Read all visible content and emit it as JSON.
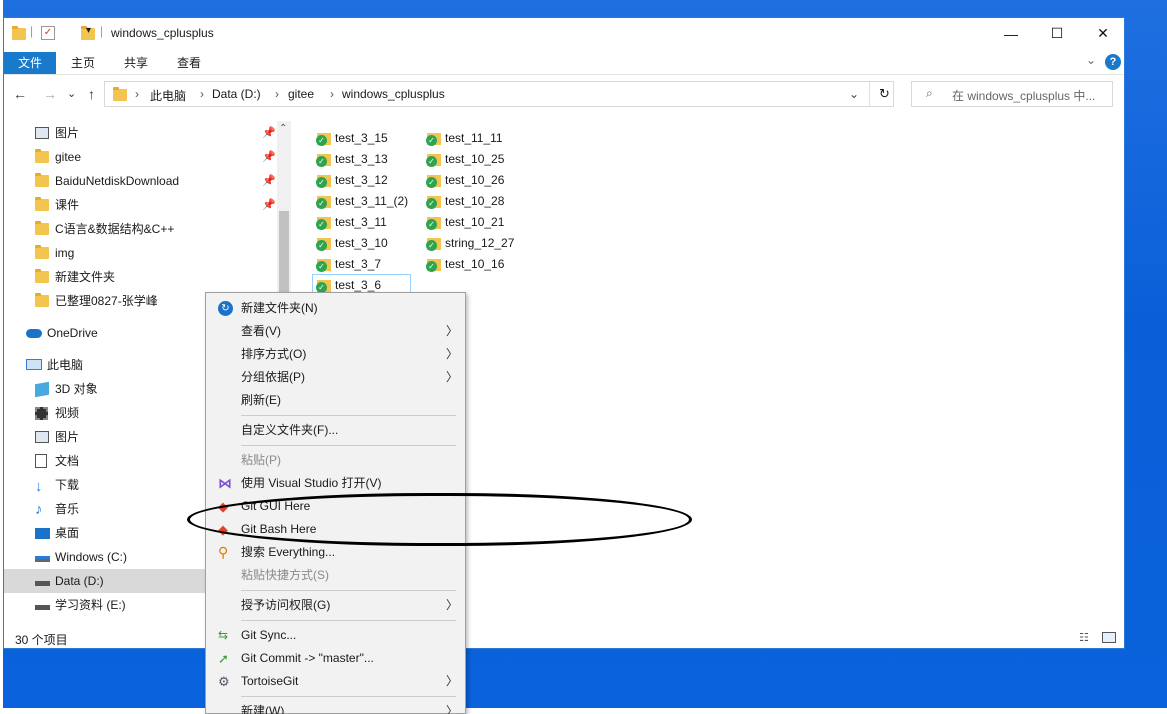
{
  "window": {
    "title": "windows_cplusplus",
    "controls": {
      "minimize": "—",
      "maximize": "☐",
      "close": "✕"
    }
  },
  "ribbon": {
    "tabs": [
      "文件",
      "主页",
      "共享",
      "查看"
    ],
    "help_icon": "?",
    "collapse_icon": "⌄"
  },
  "address": {
    "back": "←",
    "forward": "→",
    "recent": "⌄",
    "up": "↑",
    "crumbs": [
      "此电脑",
      "Data (D:)",
      "gitee",
      "windows_cplusplus"
    ],
    "separator": "›",
    "dropdown": "⌄",
    "refresh": "↻",
    "search_placeholder": "在 windows_cplusplus 中..."
  },
  "nav": {
    "quick_access": [
      {
        "label": "图片",
        "icon": "pictures-icon",
        "pinned": true
      },
      {
        "label": "gitee",
        "icon": "folder-icon",
        "pinned": true
      },
      {
        "label": "BaiduNetdiskDownload",
        "icon": "folder-icon",
        "pinned": true
      },
      {
        "label": "课件",
        "icon": "folder-icon",
        "pinned": true
      },
      {
        "label": "C语言&数据结构&C++",
        "icon": "folder-icon",
        "pinned": false
      },
      {
        "label": "img",
        "icon": "folder-icon",
        "pinned": false
      },
      {
        "label": "新建文件夹",
        "icon": "folder-icon",
        "pinned": false
      },
      {
        "label": "已整理0827-张学峰",
        "icon": "folder-icon",
        "pinned": false
      }
    ],
    "onedrive": "OneDrive",
    "this_pc": "此电脑",
    "pc_items": [
      {
        "label": "3D 对象",
        "icon": "cube-icon"
      },
      {
        "label": "视频",
        "icon": "video-icon"
      },
      {
        "label": "图片",
        "icon": "pictures-icon"
      },
      {
        "label": "文档",
        "icon": "document-icon"
      },
      {
        "label": "下载",
        "icon": "download-icon"
      },
      {
        "label": "音乐",
        "icon": "music-icon"
      },
      {
        "label": "桌面",
        "icon": "desktop-icon"
      },
      {
        "label": "Windows (C:)",
        "icon": "drive-icon"
      },
      {
        "label": "Data (D:)",
        "icon": "drive-icon"
      },
      {
        "label": "学习资料 (E:)",
        "icon": "drive-icon"
      }
    ]
  },
  "files": {
    "col1": [
      "test_3_15",
      "test_3_13",
      "test_3_12",
      "test_3_11_(2)",
      "test_3_11",
      "test_3_10",
      "test_3_7",
      "test_3_6"
    ],
    "col2": [
      "test_11_11",
      "test_10_25",
      "test_10_26",
      "test_10_28",
      "test_10_21",
      "string_12_27",
      "test_10_16"
    ]
  },
  "status": {
    "count": "30 个项目"
  },
  "context_menu": {
    "items": [
      {
        "label": "新建文件夹(N)",
        "icon": "new-folder-icon",
        "arrow": false,
        "disabled": false
      },
      {
        "label": "查看(V)",
        "icon": "",
        "arrow": true,
        "disabled": false
      },
      {
        "label": "排序方式(O)",
        "icon": "",
        "arrow": true,
        "disabled": false
      },
      {
        "label": "分组依据(P)",
        "icon": "",
        "arrow": true,
        "disabled": false
      },
      {
        "label": "刷新(E)",
        "icon": "",
        "arrow": false,
        "disabled": false
      },
      {
        "label": "自定义文件夹(F)...",
        "icon": "",
        "arrow": false,
        "disabled": false
      },
      {
        "label": "粘贴(P)",
        "icon": "",
        "arrow": false,
        "disabled": true
      },
      {
        "label": "使用 Visual Studio 打开(V)",
        "icon": "visual-studio-icon",
        "arrow": false,
        "disabled": false
      },
      {
        "label": "Git GUI Here",
        "icon": "git-icon",
        "arrow": false,
        "disabled": false
      },
      {
        "label": "Git Bash Here",
        "icon": "git-icon",
        "arrow": false,
        "disabled": false
      },
      {
        "label": "搜索 Everything...",
        "icon": "search-everything-icon",
        "arrow": false,
        "disabled": false
      },
      {
        "label": "粘贴快捷方式(S)",
        "icon": "",
        "arrow": false,
        "disabled": true
      },
      {
        "label": "授予访问权限(G)",
        "icon": "",
        "arrow": true,
        "disabled": false
      },
      {
        "label": "Git Sync...",
        "icon": "git-sync-icon",
        "arrow": false,
        "disabled": false
      },
      {
        "label": "Git Commit -> \"master\"...",
        "icon": "git-commit-icon",
        "arrow": false,
        "disabled": false
      },
      {
        "label": "TortoiseGit",
        "icon": "tortoisegit-icon",
        "arrow": true,
        "disabled": false
      },
      {
        "label": "新建(W)",
        "icon": "",
        "arrow": true,
        "disabled": false
      }
    ]
  },
  "colors": {
    "accent": "#1979ca",
    "desktop": "#0a63dc",
    "folder": "#f3c44f",
    "git_ok": "#2ea44f"
  }
}
